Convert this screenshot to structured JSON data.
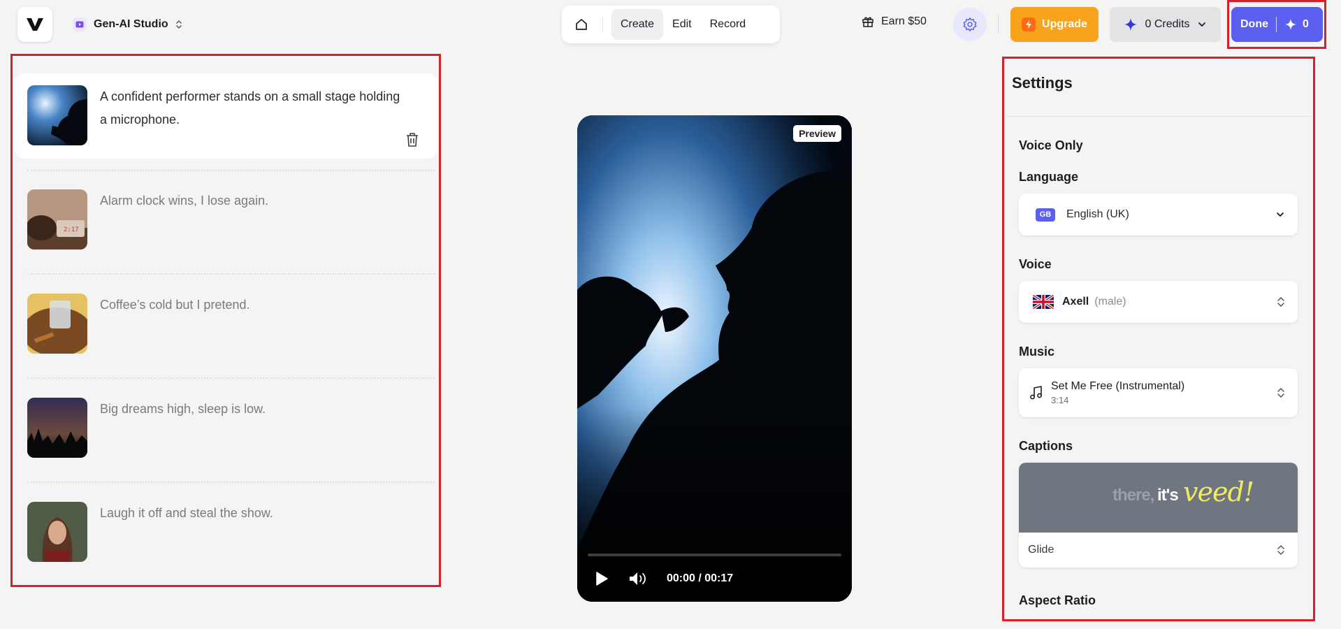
{
  "app": {
    "workspace": "Gen-AI Studio"
  },
  "nav": {
    "tabs": [
      "Create",
      "Edit",
      "Record"
    ]
  },
  "header": {
    "earn_label": "Earn $50",
    "upgrade_label": "Upgrade",
    "credits_label": "0 Credits",
    "done_label": "Done",
    "done_count": "0"
  },
  "scenes": [
    {
      "text": "A confident performer stands on a small stage holding a microphone.",
      "active": true
    },
    {
      "text": "Alarm clock wins, I lose again."
    },
    {
      "text": "Coffee’s cold but I pretend."
    },
    {
      "text": "Big dreams high, sleep is low."
    },
    {
      "text": "Laugh it off and steal the show."
    }
  ],
  "preview": {
    "badge": "Preview",
    "time": "00:00 / 00:17",
    "progress": 0
  },
  "settings": {
    "title": "Settings",
    "mode": "Voice Only",
    "language_label": "Language",
    "language_code": "GB",
    "language_value": "English (UK)",
    "voice_label": "Voice",
    "voice_name": "Axell",
    "voice_gender": "(male)",
    "music_label": "Music",
    "music_title": "Set Me Free (Instrumental)",
    "music_length": "3:14",
    "captions_label": "Captions",
    "caption_words": [
      "there,",
      "it's",
      "veed!"
    ],
    "caption_style": "Glide",
    "aspect_label": "Aspect Ratio"
  },
  "colors": {
    "accent": "#5b5ff0",
    "upgrade": "#f9a21b",
    "highlight_frame": "#d8202c"
  }
}
